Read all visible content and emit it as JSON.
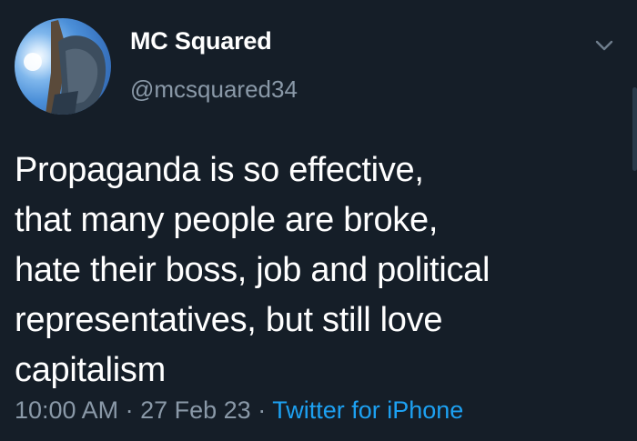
{
  "author": {
    "display_name": "MC Squared",
    "handle": "@mcsquared34",
    "avatar_icon": "profile-photo"
  },
  "tweet": {
    "text_lines": [
      "Propaganda is so effective,",
      "that many people are broke,",
      "hate their boss, job and political",
      "representatives, but still love",
      "capitalism"
    ],
    "time": "10:00 AM",
    "separator": "·",
    "date": "27 Feb 23",
    "source": "Twitter for iPhone"
  },
  "icons": {
    "menu": "chevron-down-icon"
  },
  "colors": {
    "background": "#151e28",
    "text": "#ffffff",
    "muted": "#8a99a8",
    "link": "#1da1f2"
  }
}
